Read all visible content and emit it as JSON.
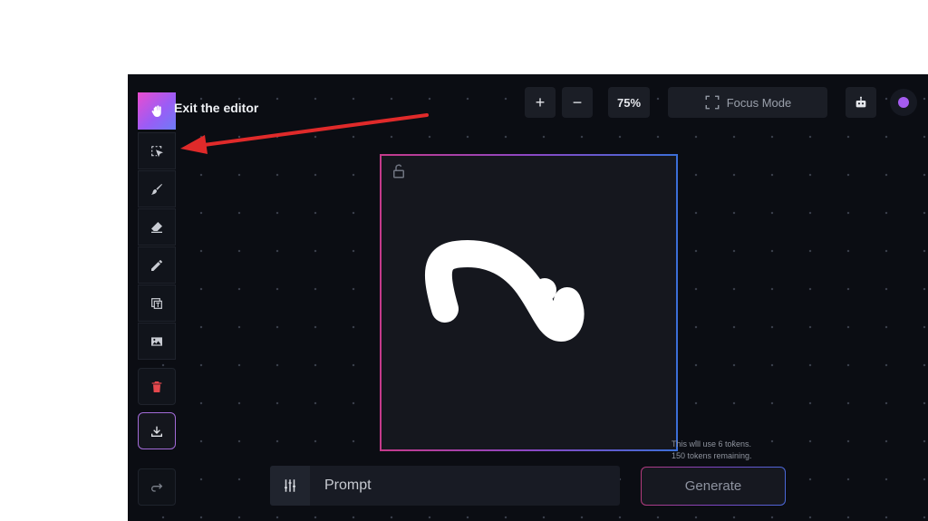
{
  "toolbar": {
    "exit_label": "Exit the editor",
    "tools": [
      {
        "name": "hand-tool",
        "icon": "hand-icon"
      },
      {
        "name": "select-tool",
        "icon": "select-cursor-icon"
      },
      {
        "name": "brush-tool",
        "icon": "brush-icon"
      },
      {
        "name": "eraser-tool",
        "icon": "eraser-icon"
      },
      {
        "name": "pencil-tool",
        "icon": "pencil-icon"
      },
      {
        "name": "text-tool",
        "icon": "text-icon"
      },
      {
        "name": "image-tool",
        "icon": "image-icon"
      },
      {
        "name": "delete-tool",
        "icon": "trash-icon"
      },
      {
        "name": "download-tool",
        "icon": "download-icon"
      },
      {
        "name": "redo-tool",
        "icon": "redo-icon"
      }
    ]
  },
  "topbar": {
    "zoom_in": "+",
    "zoom_out": "−",
    "zoom_value": "75%",
    "focus_mode_label": "Focus Mode"
  },
  "canvas": {
    "token_note_line1": "This will use 6 tokens.",
    "token_note_line2": "150 tokens remaining."
  },
  "prompt": {
    "placeholder": "Prompt"
  },
  "generate_label": "Generate",
  "colors": {
    "background": "#0b0d13",
    "accent_pink": "#ea4ccf",
    "accent_blue": "#3b6fd8",
    "delete_red": "#e5484d",
    "annotation_arrow": "#e02a2a"
  }
}
